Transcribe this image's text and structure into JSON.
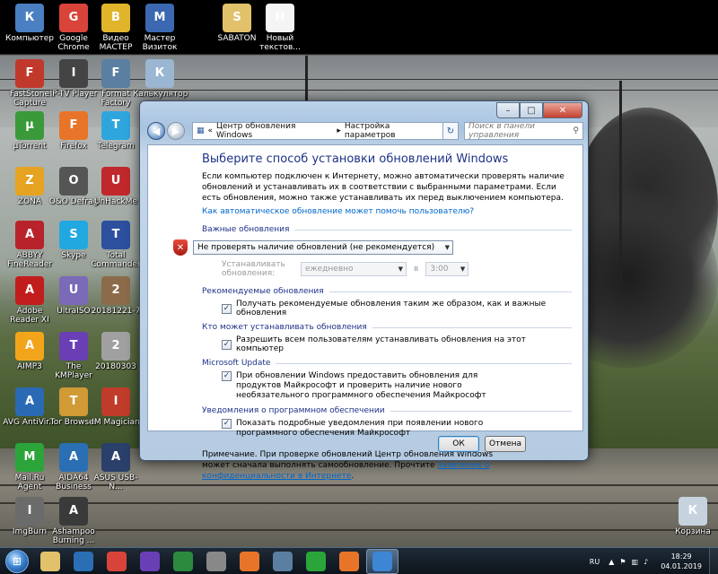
{
  "desktop": {
    "icons": [
      {
        "label": "Компьютер",
        "icon": "computer-icon",
        "color": "#4a7fc1"
      },
      {
        "label": "Google Chrome",
        "icon": "chrome-icon",
        "color": "#d9443a"
      },
      {
        "label": "Видео МАСТЕР",
        "icon": "video-master-icon",
        "color": "#e0b42b"
      },
      {
        "label": "Мастер Визиток",
        "icon": "business-card-icon",
        "color": "#3b68b0"
      },
      {
        "label": "SABATON",
        "icon": "folder-icon",
        "color": "#e2c16b"
      },
      {
        "label": "Новый текстов...",
        "icon": "text-file-icon",
        "color": "#f4f4f4"
      },
      {
        "label": "FastStone Capture",
        "icon": "faststone-icon",
        "color": "#c0392b"
      },
      {
        "label": "IP-TV Player",
        "icon": "iptv-icon",
        "color": "#444"
      },
      {
        "label": "Format Factory",
        "icon": "format-factory-icon",
        "color": "#5a7fa0"
      },
      {
        "label": "Калькулятор",
        "icon": "calculator-icon",
        "color": "#9bb6d2"
      },
      {
        "label": "µTorrent",
        "icon": "utorrent-icon",
        "color": "#3a9a3a"
      },
      {
        "label": "Firefox",
        "icon": "firefox-icon",
        "color": "#e8742a"
      },
      {
        "label": "Telegram",
        "icon": "telegram-icon",
        "color": "#2ea6dd"
      },
      {
        "label": "ZONA",
        "icon": "zona-icon",
        "color": "#e6a321"
      },
      {
        "label": "O&O Defrag",
        "icon": "defrag-icon",
        "color": "#555"
      },
      {
        "label": "UnHackMe",
        "icon": "unhackme-icon",
        "color": "#c0282c"
      },
      {
        "label": "ABBYY FineReader",
        "icon": "abbyy-icon",
        "color": "#b8232b"
      },
      {
        "label": "Skype",
        "icon": "skype-icon",
        "color": "#22a8e1"
      },
      {
        "label": "Total Commander",
        "icon": "total-commander-icon",
        "color": "#2c4f9e"
      },
      {
        "label": "Adobe Reader XI",
        "icon": "adobe-reader-icon",
        "color": "#c21d1d"
      },
      {
        "label": "UltraISO",
        "icon": "ultraiso-icon",
        "color": "#7b6ab8"
      },
      {
        "label": "20181221-7",
        "icon": "photo-icon",
        "color": "#8b6b4a"
      },
      {
        "label": "AIMP3",
        "icon": "aimp-icon",
        "color": "#f2a51b"
      },
      {
        "label": "The KMPlayer",
        "icon": "kmplayer-icon",
        "color": "#6a3fb5"
      },
      {
        "label": "20180303",
        "icon": "photo-icon",
        "color": "#a0a0a0"
      },
      {
        "label": "AVG AntiVir...",
        "icon": "avg-icon",
        "color": "#2a6ab5"
      },
      {
        "label": "Tor Browser",
        "icon": "tor-icon",
        "color": "#d09a35"
      },
      {
        "label": "IM Magician",
        "icon": "im-magician-icon",
        "color": "#c03b2a"
      },
      {
        "label": "Mail.Ru Agent",
        "icon": "mailru-agent-icon",
        "color": "#2ba53a"
      },
      {
        "label": "AIDA64 Business",
        "icon": "aida64-icon",
        "color": "#2a6fb3"
      },
      {
        "label": "ASUS USB-N...",
        "icon": "asus-usb-icon",
        "color": "#2a3f6a"
      },
      {
        "label": "ImgBurn",
        "icon": "imgburn-icon",
        "color": "#6b6b6b"
      },
      {
        "label": "Ashampoo Burning ...",
        "icon": "ashampoo-icon",
        "color": "#3a3a3a"
      },
      {
        "label": "Корзина",
        "icon": "recycle-bin-icon",
        "color": "#c6d3df"
      }
    ]
  },
  "window": {
    "breadcrumb": [
      "Центр обновления Windows",
      "Настройка параметров"
    ],
    "search_placeholder": "Поиск в панели управления",
    "title": "Выберите способ установки обновлений Windows",
    "intro": "Если компьютер подключен к Интернету, можно автоматически проверять наличие обновлений и устанавливать их в соответствии с выбранными параметрами. Если есть обновления, можно также устанавливать их перед выключением компьютера.",
    "help_link": "Как автоматическое обновление может помочь пользователю?",
    "important": {
      "header": "Важные обновления",
      "selected": "Не проверять наличие обновлений (не рекомендуется)",
      "install_label": "Устанавливать обновления:",
      "frequency": "ежедневно",
      "at": "в",
      "time": "3:00"
    },
    "recommended": {
      "header": "Рекомендуемые обновления",
      "checkbox": "Получать рекомендуемые обновления таким же образом, как и важные обновления"
    },
    "who": {
      "header": "Кто может устанавливать обновления",
      "checkbox": "Разрешить всем пользователям устанавливать обновления на этот компьютер"
    },
    "microsoft_update": {
      "header": "Microsoft Update",
      "checkbox": "При обновлении Windows предоставить обновления для продуктов Майкрософт и проверить наличие нового необязательного программного обеспечения Майкрософт"
    },
    "notifications": {
      "header": "Уведомления о программном обеспечении",
      "checkbox": "Показать подробные уведомления при появлении нового программного обеспечения Майкрософт"
    },
    "note_prefix": "Примечание. При проверке обновлений Центр обновления Windows может сначала выполнять самообновление. Прочтите",
    "privacy_link": "заявление о конфиденциальности в Интернете",
    "note_suffix": ".",
    "ok": "ОК",
    "cancel": "Отмена"
  },
  "taskbar": {
    "apps": [
      {
        "icon": "explorer-icon",
        "color": "#e2c16b"
      },
      {
        "icon": "ie-icon",
        "color": "#2a6fb3"
      },
      {
        "icon": "chrome-icon",
        "color": "#d9443a"
      },
      {
        "icon": "gear-app-icon",
        "color": "#6a3fb5"
      },
      {
        "icon": "solitaire-icon",
        "color": "#2b8a3e"
      },
      {
        "icon": "mixer-icon",
        "color": "#888"
      },
      {
        "icon": "media-player-icon",
        "color": "#e8742a"
      },
      {
        "icon": "photo-viewer-icon",
        "color": "#5a7fa0"
      },
      {
        "icon": "green-app-icon",
        "color": "#2ba53a"
      },
      {
        "icon": "firefox-icon",
        "color": "#e8742a"
      },
      {
        "icon": "control-panel-icon",
        "color": "#3d86d3"
      }
    ],
    "lang": "RU",
    "time": "18:29",
    "date": "04.01.2019"
  }
}
